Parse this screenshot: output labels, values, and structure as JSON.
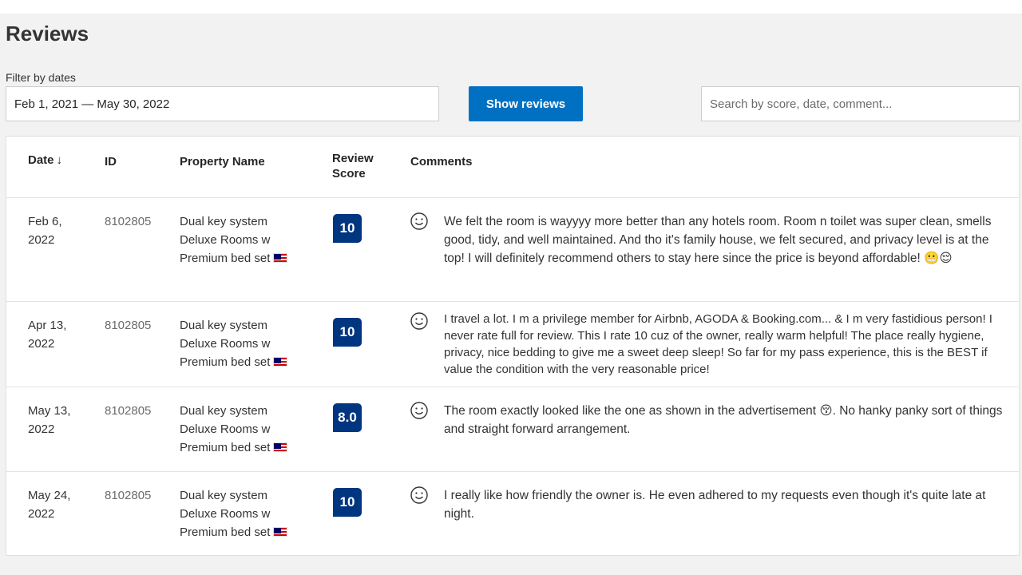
{
  "header": {
    "title": "Reviews",
    "filter_label": "Filter by dates",
    "date_range": "Feb 1, 2021 — May 30, 2022",
    "show_button": "Show reviews",
    "search_placeholder": "Search by score, date, comment..."
  },
  "table": {
    "columns": {
      "date": "Date",
      "date_sort_icon": "arrow-down",
      "id": "ID",
      "property": "Property Name",
      "score_line1": "Review",
      "score_line2": "Score",
      "comments": "Comments"
    },
    "rows": [
      {
        "date_line1": "Feb 6,",
        "date_line2": "2022",
        "id": "8102805",
        "prop_line1": "Dual key system",
        "prop_line2": "Deluxe Rooms w",
        "prop_line3": "Premium bed set",
        "score": "10",
        "comment": "We felt the room is wayyyy more better than any hotels room. Room n toilet was super clean, smells good, tidy, and well maintained. And tho it's family house, we felt secured, and privacy level is at the top! I will definitely recommend others to stay here since the price is beyond affordable! 😬😌"
      },
      {
        "date_line1": "Apr 13,",
        "date_line2": "2022",
        "id": "8102805",
        "prop_line1": "Dual key system",
        "prop_line2": "Deluxe Rooms w",
        "prop_line3": "Premium bed set",
        "score": "10",
        "comment": "I travel a lot. I m a privilege member for Airbnb, AGODA & Booking.com... & I m very fastidious person! I never rate full for review. This I rate 10 cuz of the owner, really warm helpful! The place really hygiene, privacy, nice bedding to give me a sweet deep sleep! So far for my pass experience, this is the BEST if value the condition with the very reasonable price!"
      },
      {
        "date_line1": "May 13,",
        "date_line2": "2022",
        "id": "8102805",
        "prop_line1": "Dual key system",
        "prop_line2": "Deluxe Rooms w",
        "prop_line3": "Premium bed set",
        "score": "8.0",
        "comment": "The room exactly looked like the one as shown in the advertisement 😚. No hanky panky sort of things and straight forward arrangement."
      },
      {
        "date_line1": "May 24,",
        "date_line2": "2022",
        "id": "8102805",
        "prop_line1": "Dual key system",
        "prop_line2": "Deluxe Rooms w",
        "prop_line3": "Premium bed set",
        "score": "10",
        "comment": "I really like how friendly the owner is. He even adhered to my requests even though it's quite late at night."
      }
    ]
  },
  "colors": {
    "accent": "#0071c2",
    "score_badge": "#003580"
  }
}
